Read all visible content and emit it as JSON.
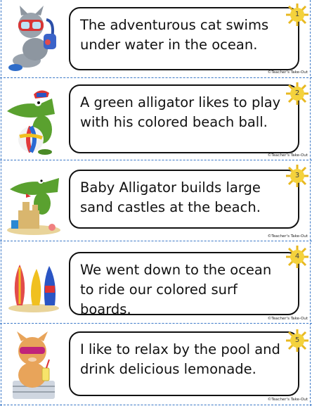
{
  "cards": [
    {
      "number": "1",
      "sentence": "The adventurous cat swims under water in the ocean.",
      "credit": "©Teacher's Take-Out",
      "picture": "cat-scuba-diver-picture"
    },
    {
      "number": "2",
      "sentence": "A green alligator likes to play with his colored beach ball.",
      "credit": "©Teacher's Take-Out",
      "picture": "alligator-beach-ball-picture"
    },
    {
      "number": "3",
      "sentence": "Baby Alligator builds large sand castles at the beach.",
      "credit": "©Teacher's Take-Out",
      "picture": "alligator-sand-castle-picture"
    },
    {
      "number": "4",
      "sentence": "We went down to the ocean to ride our colored surf boards.",
      "credit": "©Teacher's Take-Out",
      "picture": "surfboards-picture"
    },
    {
      "number": "5",
      "sentence": "I like to relax by the pool and drink delicious lemonade.",
      "credit": "©Teacher's Take-Out",
      "picture": "cat-lemonade-picture"
    }
  ],
  "colors": {
    "cut_line": "#3b78c8",
    "sun": "#f4d23c",
    "sun_ray": "#e8b820",
    "border": "#111111"
  }
}
